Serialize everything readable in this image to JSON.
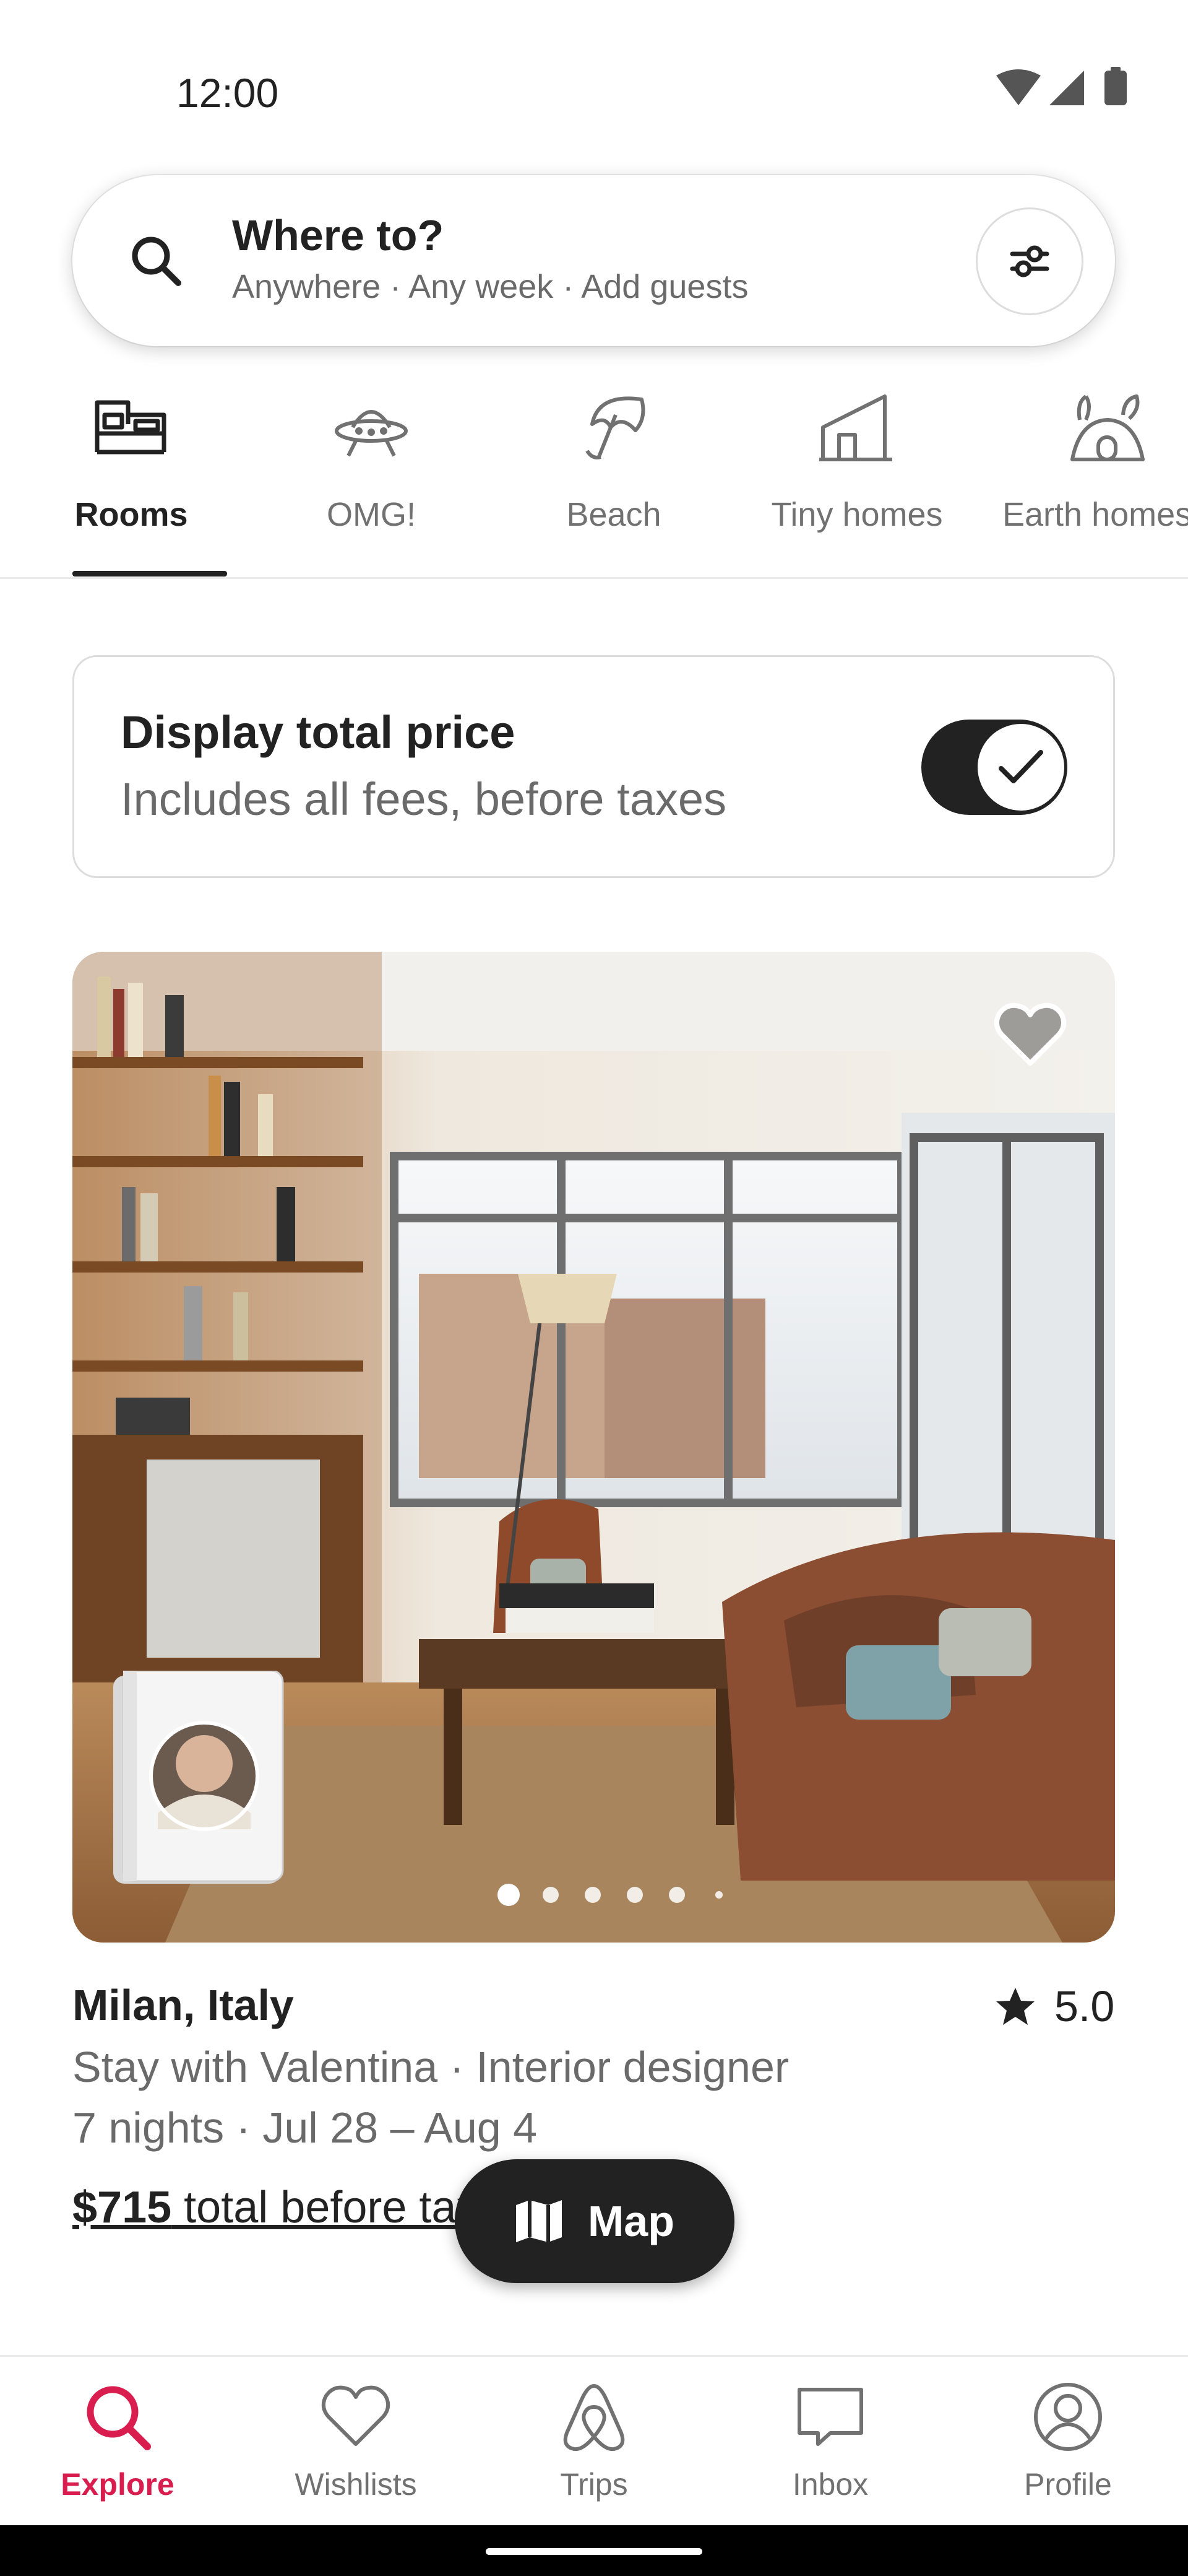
{
  "status_bar": {
    "time": "12:00"
  },
  "search": {
    "title": "Where to?",
    "subtitle": "Anywhere · Any week · Add guests"
  },
  "categories": [
    {
      "label": "Rooms",
      "icon": "bed-icon",
      "active": true
    },
    {
      "label": "OMG!",
      "icon": "ufo-icon",
      "active": false
    },
    {
      "label": "Beach",
      "icon": "beach-umbrella-icon",
      "active": false
    },
    {
      "label": "Tiny homes",
      "icon": "tiny-home-icon",
      "active": false
    },
    {
      "label": "Earth homes",
      "icon": "earth-home-icon",
      "active": false
    }
  ],
  "price_toggle": {
    "title": "Display total price",
    "subtitle": "Includes all fees, before taxes",
    "enabled": true
  },
  "listing": {
    "location": "Milan, Italy",
    "rating": "5.0",
    "host_line": "Stay with Valentina · Interior designer",
    "dates": "7 nights · Jul 28 – Aug 4",
    "price": "$715",
    "price_suffix": " total before taxes",
    "photo_count": 6,
    "current_photo": 1
  },
  "map_button": {
    "label": "Map"
  },
  "bottom_nav": [
    {
      "label": "Explore",
      "icon": "search-icon",
      "active": true
    },
    {
      "label": "Wishlists",
      "icon": "heart-icon",
      "active": false
    },
    {
      "label": "Trips",
      "icon": "airbnb-logo-icon",
      "active": false
    },
    {
      "label": "Inbox",
      "icon": "message-icon",
      "active": false
    },
    {
      "label": "Profile",
      "icon": "profile-icon",
      "active": false
    }
  ],
  "colors": {
    "accent": "#d91e4f",
    "text": "#222222",
    "muted": "#717171"
  }
}
